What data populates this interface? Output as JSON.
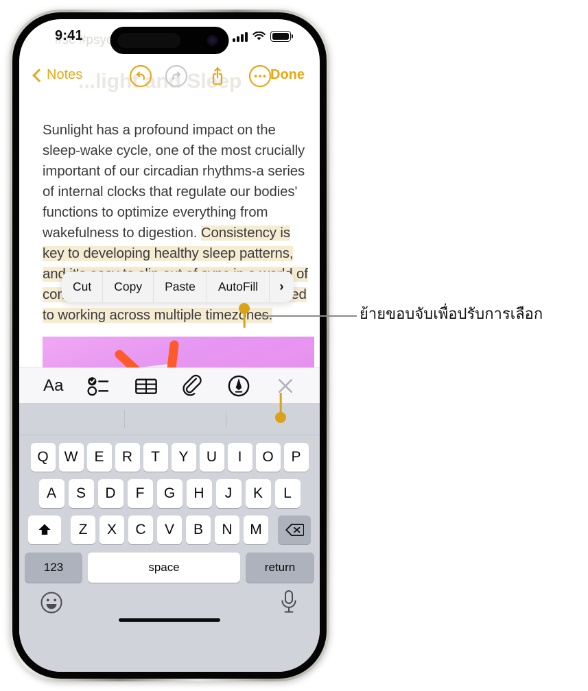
{
  "status_bar": {
    "time": "9:41",
    "cellular_icon": "cellular-signal-icon",
    "wifi_icon": "wifi-icon",
    "battery_icon": "battery-full-icon"
  },
  "faded_header": {
    "tags": "#sc  #psyc",
    "title": "...light and Sleep"
  },
  "nav_bar": {
    "back_label": "Notes",
    "back_icon": "chevron-left-icon",
    "undo_icon": "undo-icon",
    "redo_icon": "redo-icon",
    "share_icon": "share-icon",
    "more_icon": "ellipsis-circle-icon",
    "done_label": "Done"
  },
  "note": {
    "text_before_selection": "Sunlight has a profound impact on the sleep-wake cycle, one of the most crucially important of our circadian rhythms-a series of internal clocks that regulate our bodies' functions to optimize everything from wakefulness to digestion. ",
    "selected_text": "Consistency is key to developing healthy sleep patterns, and it's easy to slip out of sync in a world of constant connection, where many are used to working across multiple timezones.",
    "attachment_name": "molecule-image-attachment",
    "selection_highlight_color": "#f5ecd2",
    "handle_color": "#d9a219"
  },
  "edit_menu": {
    "items": [
      {
        "label": "Cut",
        "name": "menu-item-cut"
      },
      {
        "label": "Copy",
        "name": "menu-item-copy"
      },
      {
        "label": "Paste",
        "name": "menu-item-paste"
      },
      {
        "label": "AutoFill",
        "name": "menu-item-autofill"
      }
    ],
    "more_chevron": "›"
  },
  "format_toolbar": {
    "buttons": [
      {
        "label": "Aa",
        "name": "text-format-button"
      },
      {
        "label": "",
        "name": "checklist-button"
      },
      {
        "label": "",
        "name": "table-button"
      },
      {
        "label": "",
        "name": "attachment-button"
      },
      {
        "label": "",
        "name": "markup-button"
      },
      {
        "label": "",
        "name": "close-keyboard-button"
      }
    ]
  },
  "keyboard": {
    "row1": [
      "Q",
      "W",
      "E",
      "R",
      "T",
      "Y",
      "U",
      "I",
      "O",
      "P"
    ],
    "row2": [
      "A",
      "S",
      "D",
      "F",
      "G",
      "H",
      "J",
      "K",
      "L"
    ],
    "row3": [
      "Z",
      "X",
      "C",
      "V",
      "B",
      "N",
      "M"
    ],
    "shift_icon": "shift-icon",
    "delete_icon": "delete-backward-icon",
    "numbers_label": "123",
    "space_label": "space",
    "return_label": "return",
    "emoji_icon": "emoji-icon",
    "dictate_icon": "microphone-icon"
  },
  "callout": {
    "text": "ย้ายขอบจับเพื่อปรับการเลือก"
  },
  "colors": {
    "accent": "#eaa713",
    "handle": "#d9a219",
    "selection": "#f5ecd2",
    "keyboard_bg": "#d1d3da"
  }
}
